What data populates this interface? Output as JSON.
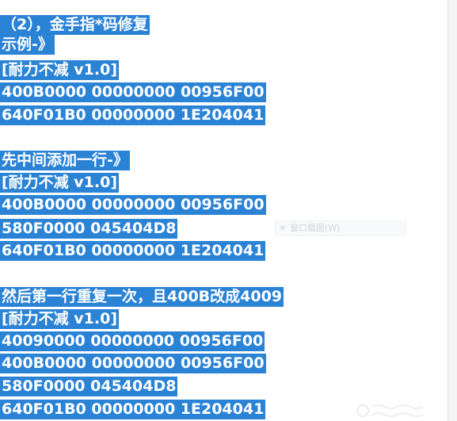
{
  "colors": {
    "selection": "#2b83d6",
    "selected_text": "#ffffff",
    "background": "#ffffff"
  },
  "tooltip": {
    "label": "窗口截图(W)"
  },
  "lines": [
    "（2），金手指*码修复",
    "示例-》",
    "[耐力不减 v1.0]",
    "400B0000 00000000 00956F00",
    "640F01B0 00000000 1E204041",
    "",
    "先中间添加一行-》",
    "[耐力不减 v1.0]",
    "400B0000 00000000 00956F00",
    "580F0000 045404D8",
    "640F01B0 00000000 1E204041",
    "",
    "然后第一行重复一次，且400B改成4009",
    "[耐力不减 v1.0]",
    "40090000 00000000 00956F00",
    "400B0000 00000000 00956F00",
    "580F0000 045404D8",
    "640F01B0 00000000 1E204041"
  ]
}
